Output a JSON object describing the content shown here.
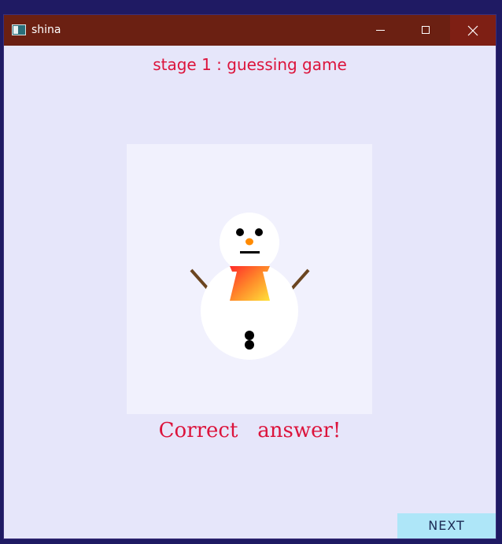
{
  "window": {
    "title": "shina",
    "icon": "app-window-icon",
    "controls": [
      "minimize-icon",
      "maximize-icon",
      "close-icon"
    ]
  },
  "stage": {
    "title": "stage 1 : guessing game"
  },
  "picture": {
    "subject": "snowman-icon"
  },
  "result": {
    "message": "Correct   answer!"
  },
  "footer": {
    "next_label": "NEXT"
  },
  "colors": {
    "background": "#e6e6fa",
    "titlebar": "#6b2012",
    "accent_text": "#dc143c",
    "next_button": "#aee6f8"
  }
}
